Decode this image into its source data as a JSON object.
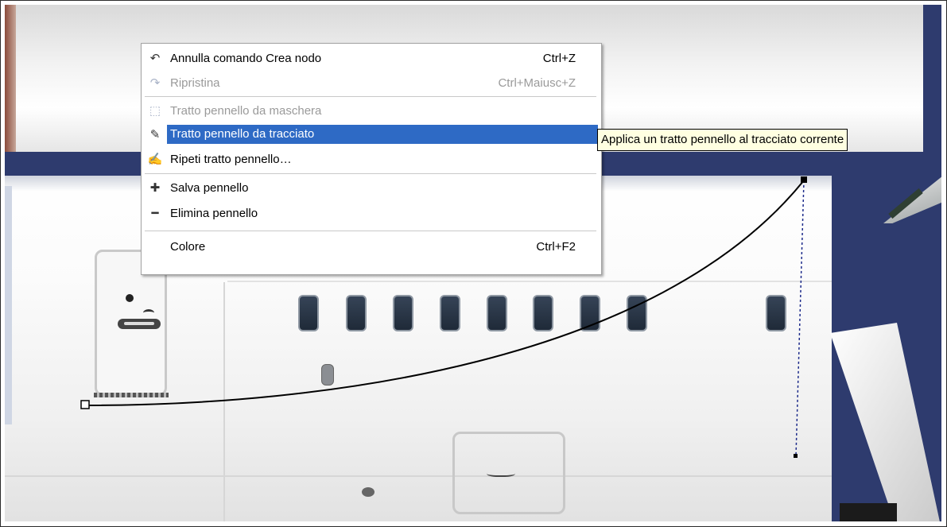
{
  "context_menu": {
    "items": [
      {
        "label": "Annulla comando Crea nodo",
        "shortcut": "Ctrl+Z",
        "icon": "undo-icon",
        "enabled": true
      },
      {
        "label": "Ripristina",
        "shortcut": "Ctrl+Maiusc+Z",
        "icon": "redo-icon",
        "enabled": false
      },
      {
        "label": "Tratto pennello da maschera",
        "shortcut": "",
        "icon": "stroke-selection-icon",
        "enabled": false
      },
      {
        "label": "Tratto pennello da tracciato",
        "shortcut": "",
        "icon": "stroke-path-icon",
        "enabled": true,
        "highlighted": true
      },
      {
        "label": "Ripeti tratto pennello…",
        "shortcut": "",
        "icon": "repeat-stroke-icon",
        "enabled": true
      },
      {
        "label": "Salva pennello",
        "shortcut": "",
        "icon": "plus-icon",
        "enabled": true
      },
      {
        "label": "Elimina pennello",
        "shortcut": "",
        "icon": "minus-icon",
        "enabled": true
      },
      {
        "label": "Colore",
        "shortcut": "Ctrl+F2",
        "icon": "",
        "enabled": true
      }
    ]
  },
  "tooltip": {
    "text": "Applica un tratto pennello al tracciato corrente"
  },
  "colors": {
    "highlight": "#2e6ac5",
    "background": "#2e3b6e",
    "tooltip_bg": "#ffffe1"
  }
}
